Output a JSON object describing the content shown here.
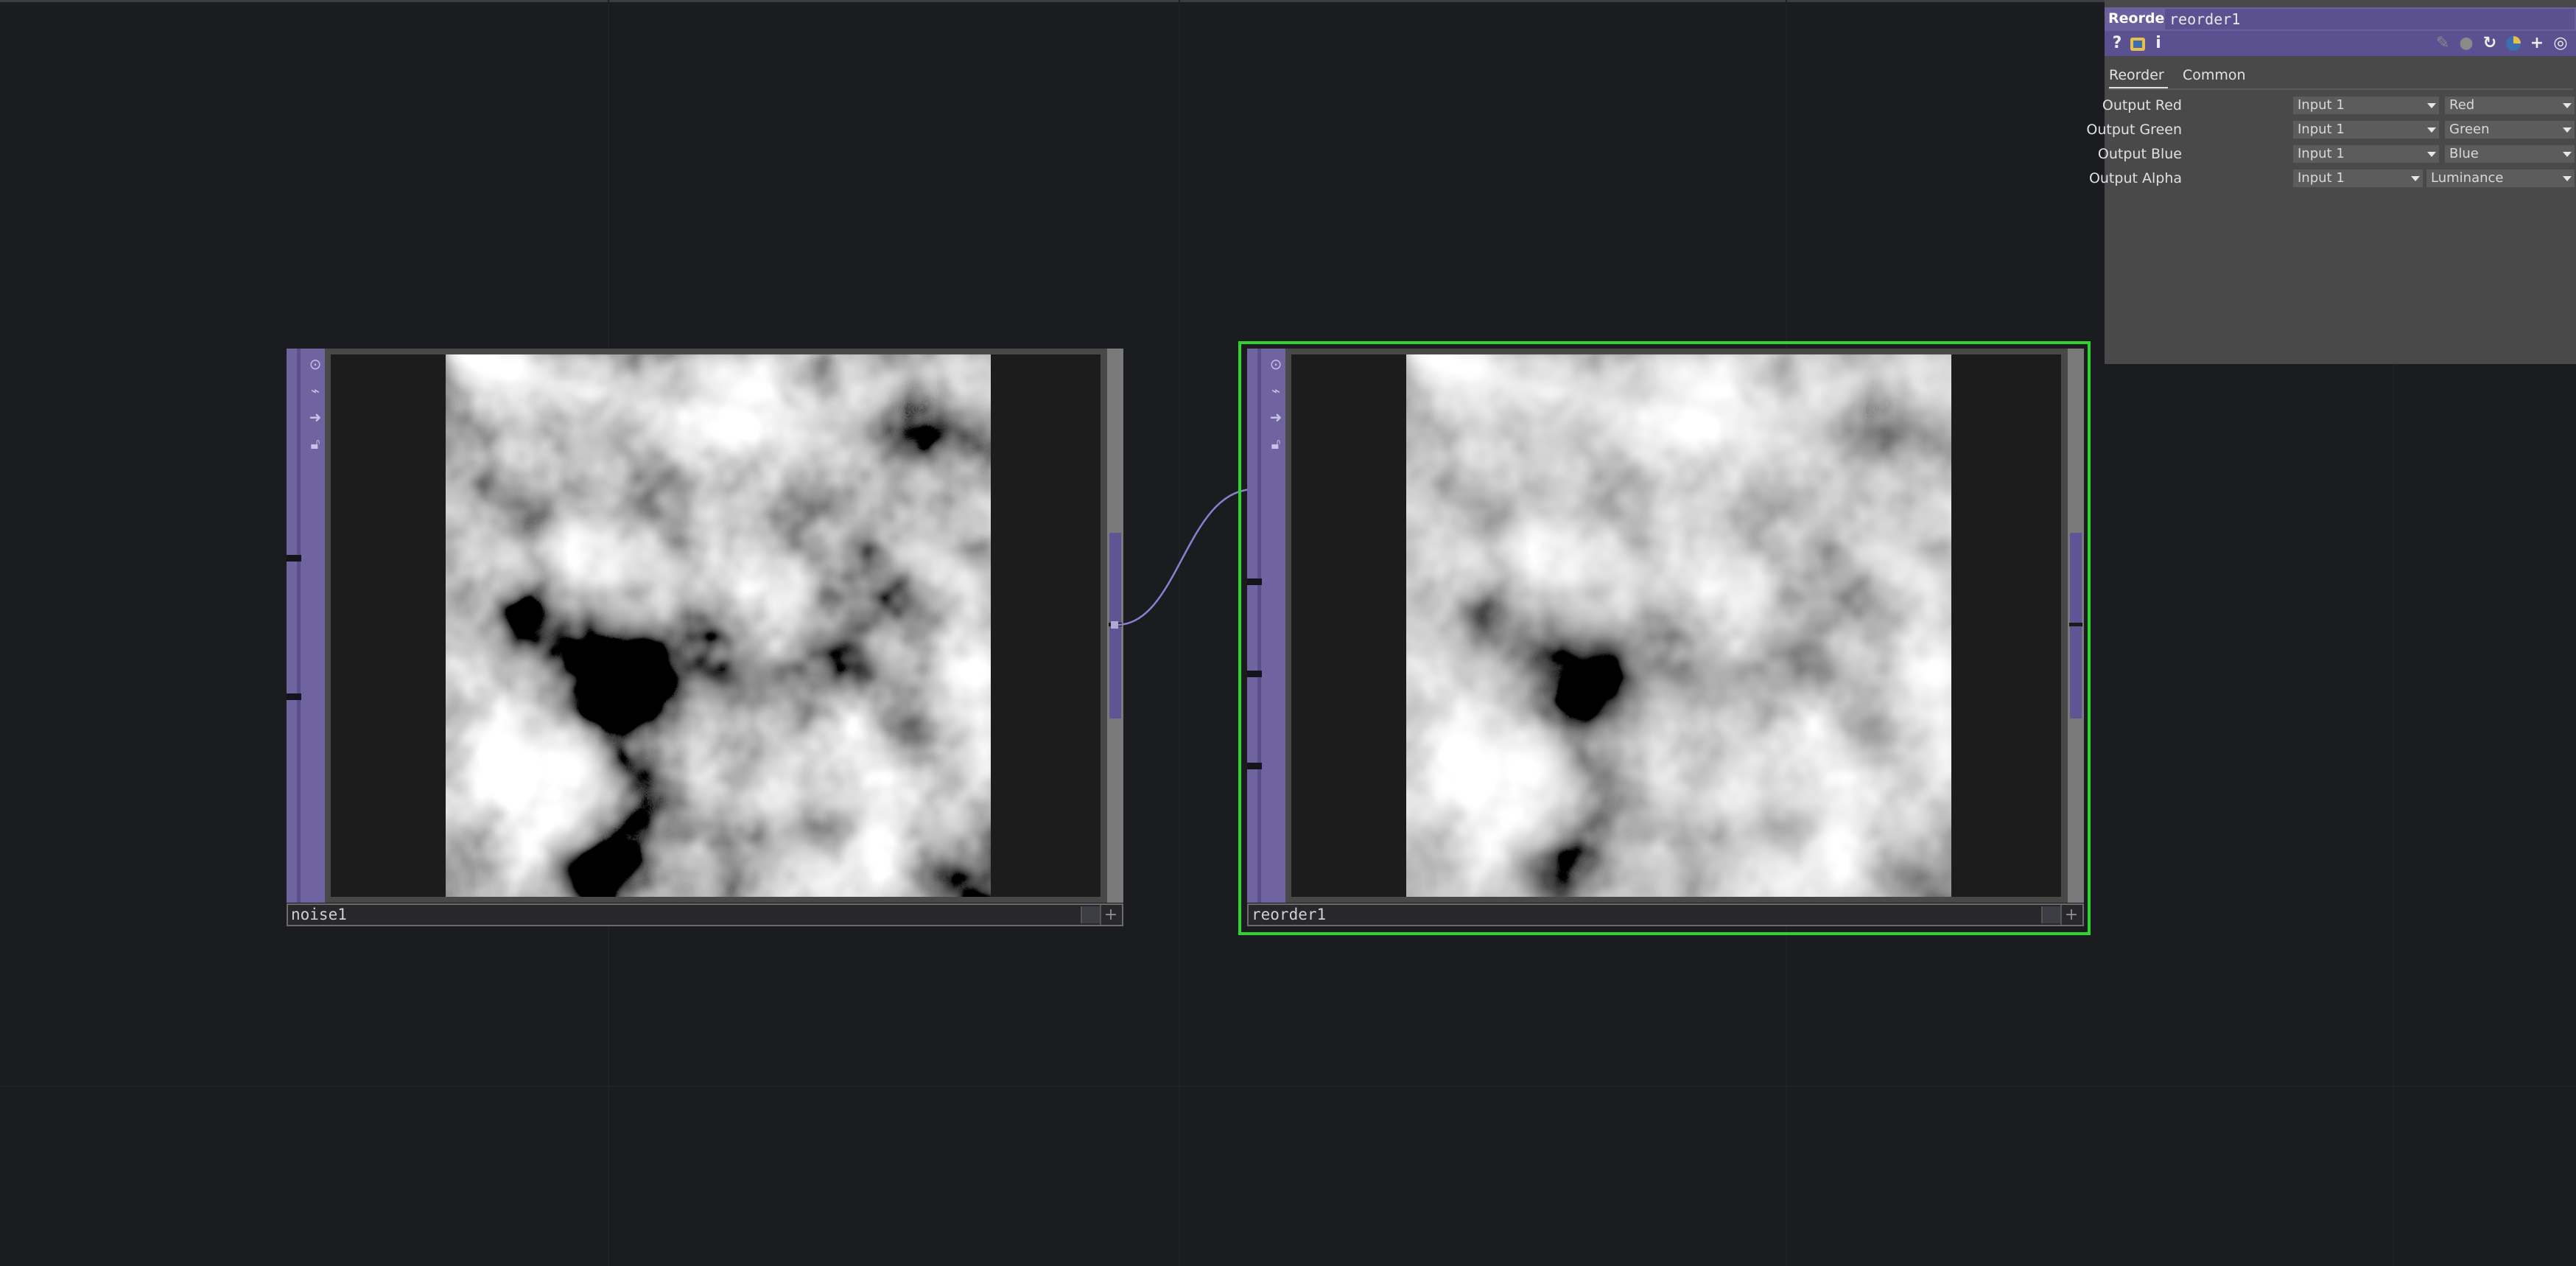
{
  "network": {
    "nodes": [
      {
        "name": "noise1"
      },
      {
        "name": "reorder1"
      }
    ],
    "selection_color": "#2fd32f",
    "node_color": "#6f63a0",
    "wire_color": "#8a7fd0"
  },
  "panel": {
    "op_type": "Reorder",
    "op_name": "reorder1",
    "toolbar_icons": [
      "help-icon",
      "python-help-icon",
      "info-icon",
      "edit-icon",
      "comment-icon",
      "reset-icon",
      "python-icon",
      "add-icon",
      "target-icon"
    ],
    "toolbar_glyphs": {
      "help": "?",
      "info": "i",
      "add": "+"
    },
    "tabs": [
      "Reorder",
      "Common"
    ],
    "params": [
      {
        "label": "Output Red",
        "source": "Input 1",
        "channel": "Red"
      },
      {
        "label": "Output Green",
        "source": "Input 1",
        "channel": "Green"
      },
      {
        "label": "Output Blue",
        "source": "Input 1",
        "channel": "Blue"
      },
      {
        "label": "Output Alpha",
        "source": "Input 1",
        "channel": "Luminance"
      }
    ]
  }
}
